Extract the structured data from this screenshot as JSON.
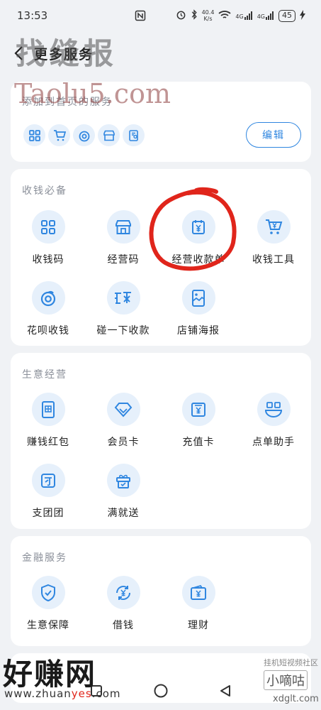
{
  "status_bar": {
    "time": "13:53",
    "network_speed_top": "40.4",
    "network_speed_bottom": "K/s",
    "signal_1": "4G",
    "signal_2": "4G",
    "battery": "45"
  },
  "header": {
    "title": "更多服务"
  },
  "home_section": {
    "title": "添加到首页的服务",
    "icons": [
      "grid-qr-icon",
      "cart-yuan-icon",
      "spiral-icon",
      "shop-icon",
      "card-person-icon"
    ],
    "edit_label": "编辑"
  },
  "collect_section": {
    "title": "收钱必备",
    "items": [
      {
        "label": "收钱码",
        "icon": "qr-code-icon"
      },
      {
        "label": "经营码",
        "icon": "shop-icon"
      },
      {
        "label": "经营收款单",
        "icon": "receipt-yuan-icon"
      },
      {
        "label": "收钱工具",
        "icon": "cart-yuan-icon"
      },
      {
        "label": "花呗收钱",
        "icon": "spiral-icon"
      },
      {
        "label": "碰一下收款",
        "icon": "touch-text-icon"
      },
      {
        "label": "店铺海报",
        "icon": "poster-icon"
      }
    ]
  },
  "biz_section": {
    "title": "生意经营",
    "items": [
      {
        "label": "赚钱红包",
        "icon": "red-packet-icon"
      },
      {
        "label": "会员卡",
        "icon": "diamond-icon"
      },
      {
        "label": "充值卡",
        "icon": "recharge-card-icon"
      },
      {
        "label": "点单助手",
        "icon": "order-bowl-icon"
      },
      {
        "label": "支团团",
        "icon": "group-icon"
      },
      {
        "label": "满就送",
        "icon": "gift-icon"
      }
    ]
  },
  "finance_section": {
    "title": "金融服务",
    "items": [
      {
        "label": "生意保障",
        "icon": "shield-check-icon"
      },
      {
        "label": "借钱",
        "icon": "loan-cycle-icon"
      },
      {
        "label": "理财",
        "icon": "wallet-yuan-icon"
      }
    ]
  },
  "watermarks": {
    "top_text": "找缝报",
    "top_url": "Taolu5.com",
    "bottom_left": "好赚网",
    "bottom_left_url_a": "www.zhuan",
    "bottom_left_url_b": "yes",
    "bottom_left_url_c": ".com",
    "bottom_right_small": "挂机短视频社区",
    "bottom_right_brand": "小嘀咕",
    "bottom_right_url": "xdglt.com"
  },
  "colors": {
    "accent": "#2f86e0",
    "icon_bg": "#e6f0fb",
    "page_bg": "#f0f2f5",
    "annotation": "#e0251b"
  }
}
